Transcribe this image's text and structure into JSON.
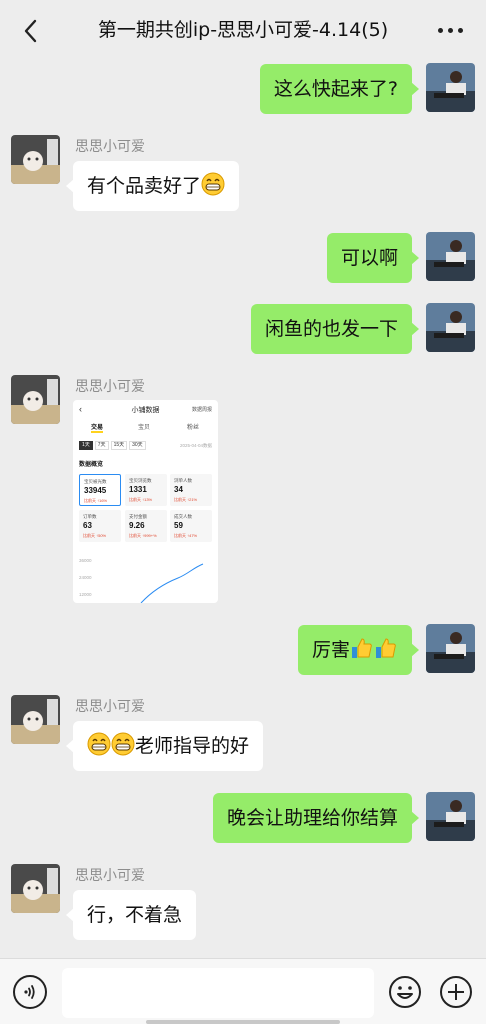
{
  "header": {
    "title": "第一期共创ip-思思小可爱-4.14(5)"
  },
  "contact": {
    "name": "思思小可爱"
  },
  "messages": {
    "m1": "这么快起来了?",
    "m2": "有个品卖好了",
    "m3": "可以啊",
    "m4": "闲鱼的也发一下",
    "m6": "厉害",
    "m7": "老师指导的好",
    "m8": "晚会让助理给你结算",
    "m9": "行，不着急"
  },
  "shared_screenshot": {
    "title": "小铺数据",
    "header_right": "数据周报",
    "tabs": [
      "交易",
      "宝贝",
      "粉丝"
    ],
    "ranges": [
      "1天",
      "7天",
      "15天",
      "30天"
    ],
    "date": "2025-04-04数据",
    "section": "数据概览",
    "cards": [
      {
        "label": "宝贝被光数",
        "value": "33945",
        "change": "比前天 ↑16%"
      },
      {
        "label": "宝贝浏览数",
        "value": "1331",
        "change": "比前天 ↑13%"
      },
      {
        "label": "浏单人数",
        "value": "34",
        "change": "比前天 ↑21%"
      },
      {
        "label": "订单数",
        "value": "63",
        "change": "比前天 ↑50%"
      },
      {
        "label": "支付金额",
        "value": "9.26",
        "change": "比前天 ↑999+%"
      },
      {
        "label": "成交人数",
        "value": "59",
        "change": "比前天 ↑47%"
      }
    ],
    "axis_labels": [
      "36000",
      "24000",
      "12000"
    ]
  },
  "input": {
    "placeholder": ""
  },
  "colors": {
    "bg": "#ededed",
    "self_bubble": "#95ec69",
    "other_bubble": "#ffffff"
  }
}
